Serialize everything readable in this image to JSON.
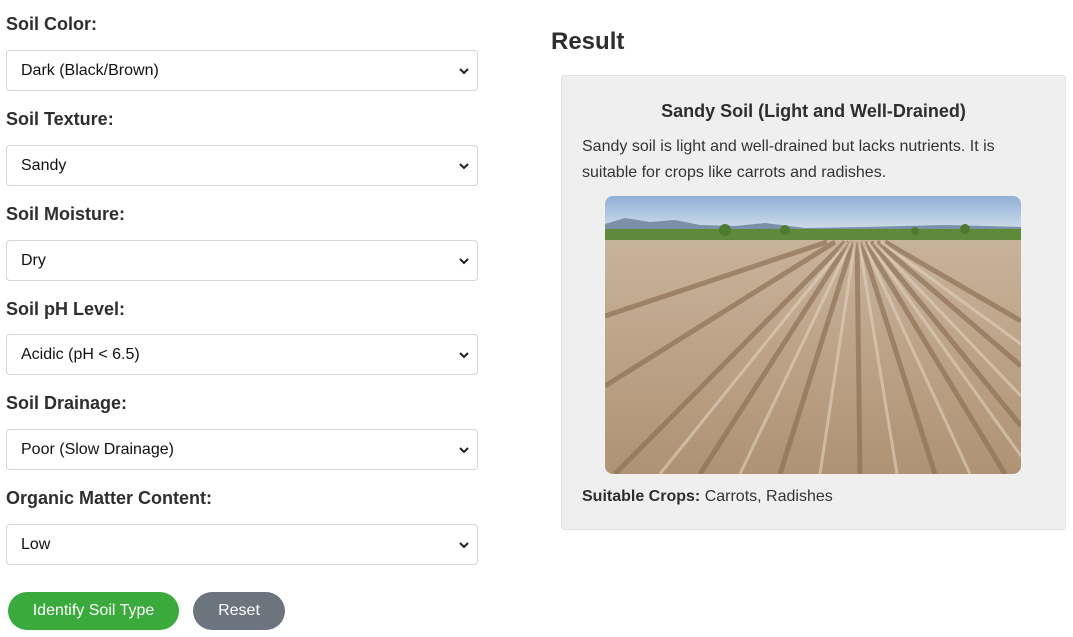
{
  "form": {
    "fields": [
      {
        "label": "Soil Color:",
        "value": "Dark (Black/Brown)"
      },
      {
        "label": "Soil Texture:",
        "value": "Sandy"
      },
      {
        "label": "Soil Moisture:",
        "value": "Dry"
      },
      {
        "label": "Soil pH Level:",
        "value": "Acidic (pH < 6.5)"
      },
      {
        "label": "Soil Drainage:",
        "value": "Poor (Slow Drainage)"
      },
      {
        "label": "Organic Matter Content:",
        "value": "Low"
      }
    ],
    "identify_label": "Identify Soil Type",
    "reset_label": "Reset"
  },
  "result": {
    "heading": "Result",
    "soil_title": "Sandy Soil (Light and Well-Drained)",
    "description": "Sandy soil is light and well-drained but lacks nutrients. It is suitable for crops like carrots and radishes.",
    "crops_label": "Suitable Crops:",
    "crops_value": "Carrots, Radishes"
  },
  "colors": {
    "identify_button": "#3aaa3d",
    "reset_button": "#6c757d",
    "card_background": "#efefef"
  }
}
